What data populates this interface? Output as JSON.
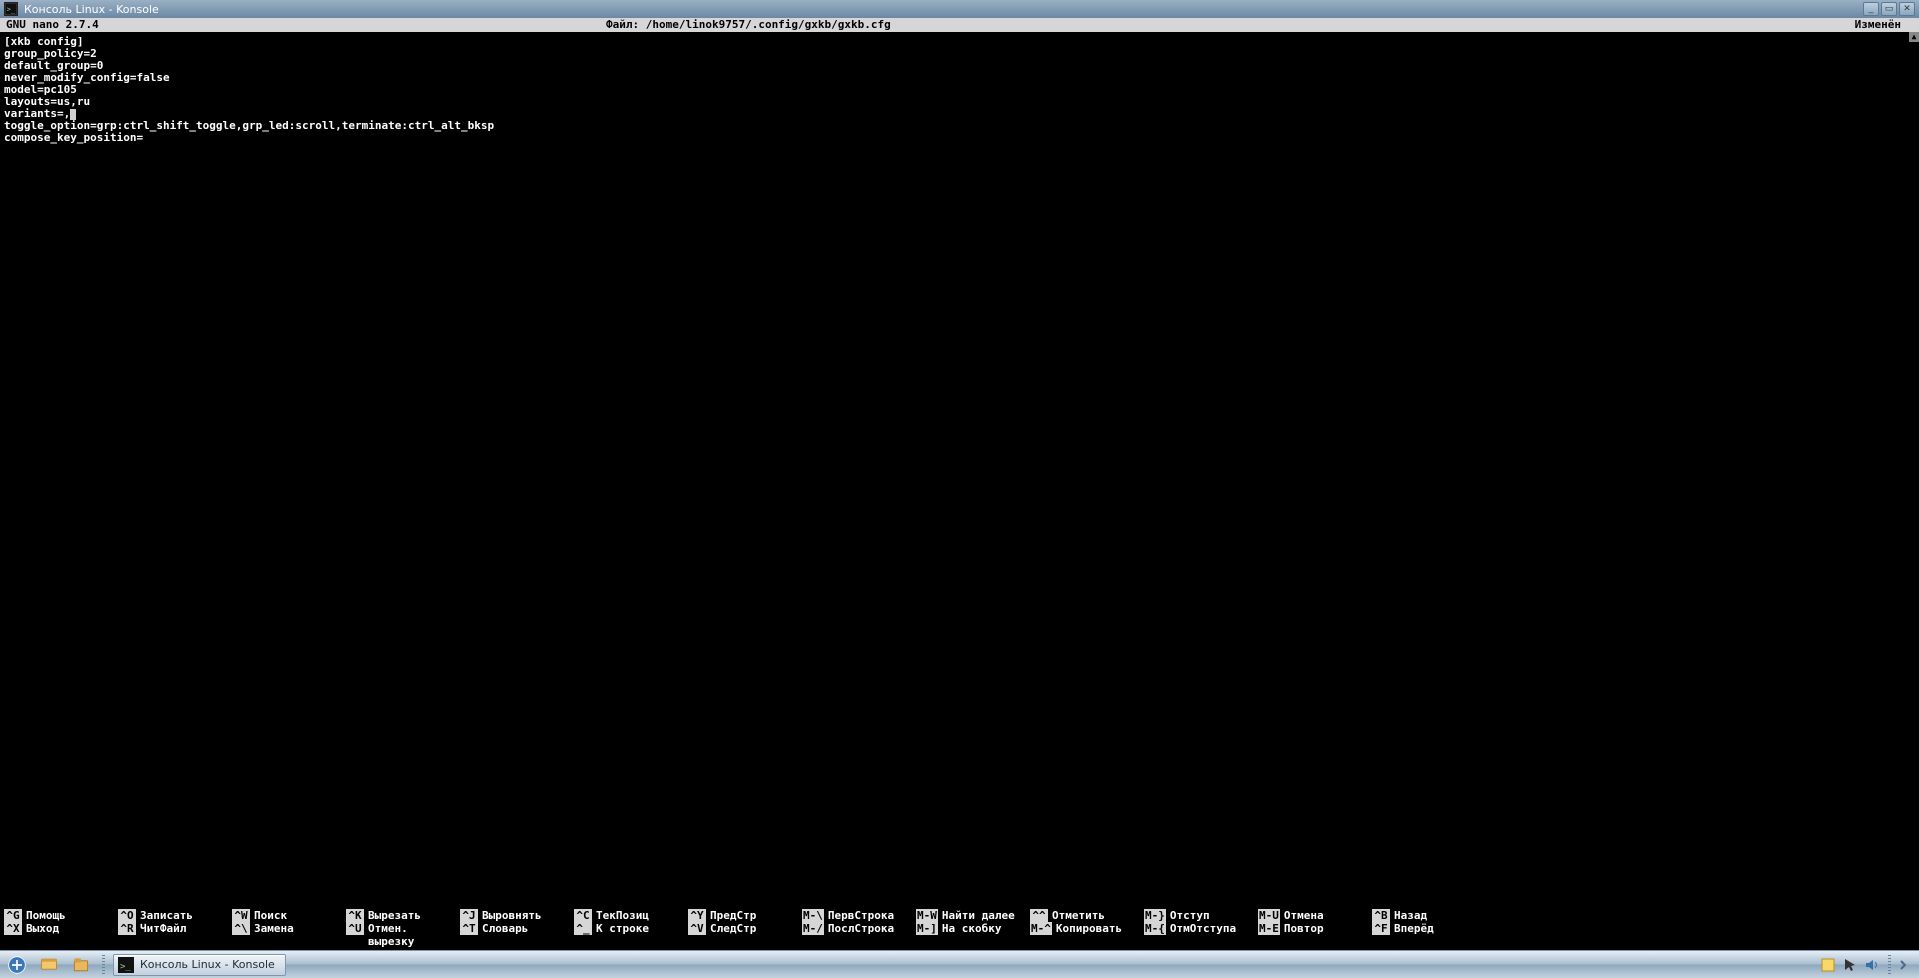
{
  "window": {
    "title": "Консоль Linux - Konsole"
  },
  "nano": {
    "version": "  GNU nano 2.7.4",
    "file_label": "Файл: /home/linok9757/.config/gxkb/gxkb.cfg",
    "modified": "Изменён"
  },
  "content": {
    "lines": [
      "[xkb config]",
      "group_policy=2",
      "default_group=0",
      "never_modify_config=false",
      "model=pc105",
      "layouts=us,ru",
      "variants=,",
      "toggle_option=grp:ctrl_shift_toggle,grp_led:scroll,terminate:ctrl_alt_bksp",
      "compose_key_position="
    ],
    "cursor_line": 6
  },
  "shortcuts": {
    "row1": [
      {
        "key": "^G",
        "label": "Помощь"
      },
      {
        "key": "^O",
        "label": "Записать"
      },
      {
        "key": "^W",
        "label": "Поиск"
      },
      {
        "key": "^K",
        "label": "Вырезать"
      },
      {
        "key": "^J",
        "label": "Выровнять"
      },
      {
        "key": "^C",
        "label": "ТекПозиц"
      },
      {
        "key": "^Y",
        "label": "ПредСтр"
      },
      {
        "key": "M-\\",
        "label": "ПервСтрока"
      },
      {
        "key": "M-W",
        "label": "Найти далее"
      },
      {
        "key": "^^",
        "label": "Отметить"
      },
      {
        "key": "M-}",
        "label": "Отступ"
      },
      {
        "key": "M-U",
        "label": "Отмена"
      },
      {
        "key": "^B",
        "label": "Назад"
      }
    ],
    "row2": [
      {
        "key": "^X",
        "label": "Выход"
      },
      {
        "key": "^R",
        "label": "ЧитФайл"
      },
      {
        "key": "^\\",
        "label": "Замена"
      },
      {
        "key": "^U",
        "label": "Отмен. вырезку"
      },
      {
        "key": "^T",
        "label": "Словарь"
      },
      {
        "key": "^_",
        "label": "К строке"
      },
      {
        "key": "^V",
        "label": "СледСтр"
      },
      {
        "key": "M-/",
        "label": "ПослСтрока"
      },
      {
        "key": "M-]",
        "label": "На скобку"
      },
      {
        "key": "M-^",
        "label": "Копировать"
      },
      {
        "key": "M-{",
        "label": "ОтмОтступа"
      },
      {
        "key": "M-E",
        "label": "Повтор"
      },
      {
        "key": "^F",
        "label": "Вперёд"
      }
    ]
  },
  "taskbar": {
    "task_label": "Консоль Linux - Konsole"
  }
}
